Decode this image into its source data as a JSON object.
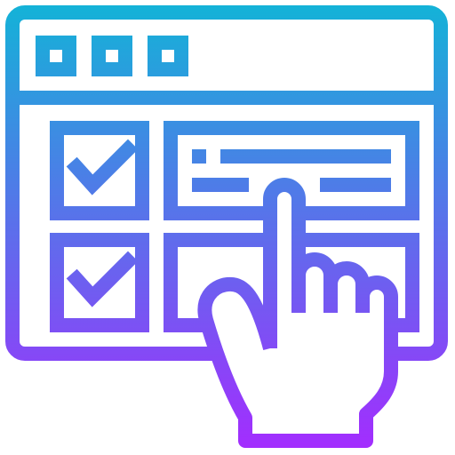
{
  "illustration": {
    "icon": "web-form-checklist-hand-icon",
    "window_icon": "browser-window-icon",
    "checkbox_icon": "checkmark-icon",
    "hand_icon": "pointing-hand-icon",
    "gradient": {
      "top": "#12B4D7",
      "bottom": "#A52BFF"
    }
  }
}
